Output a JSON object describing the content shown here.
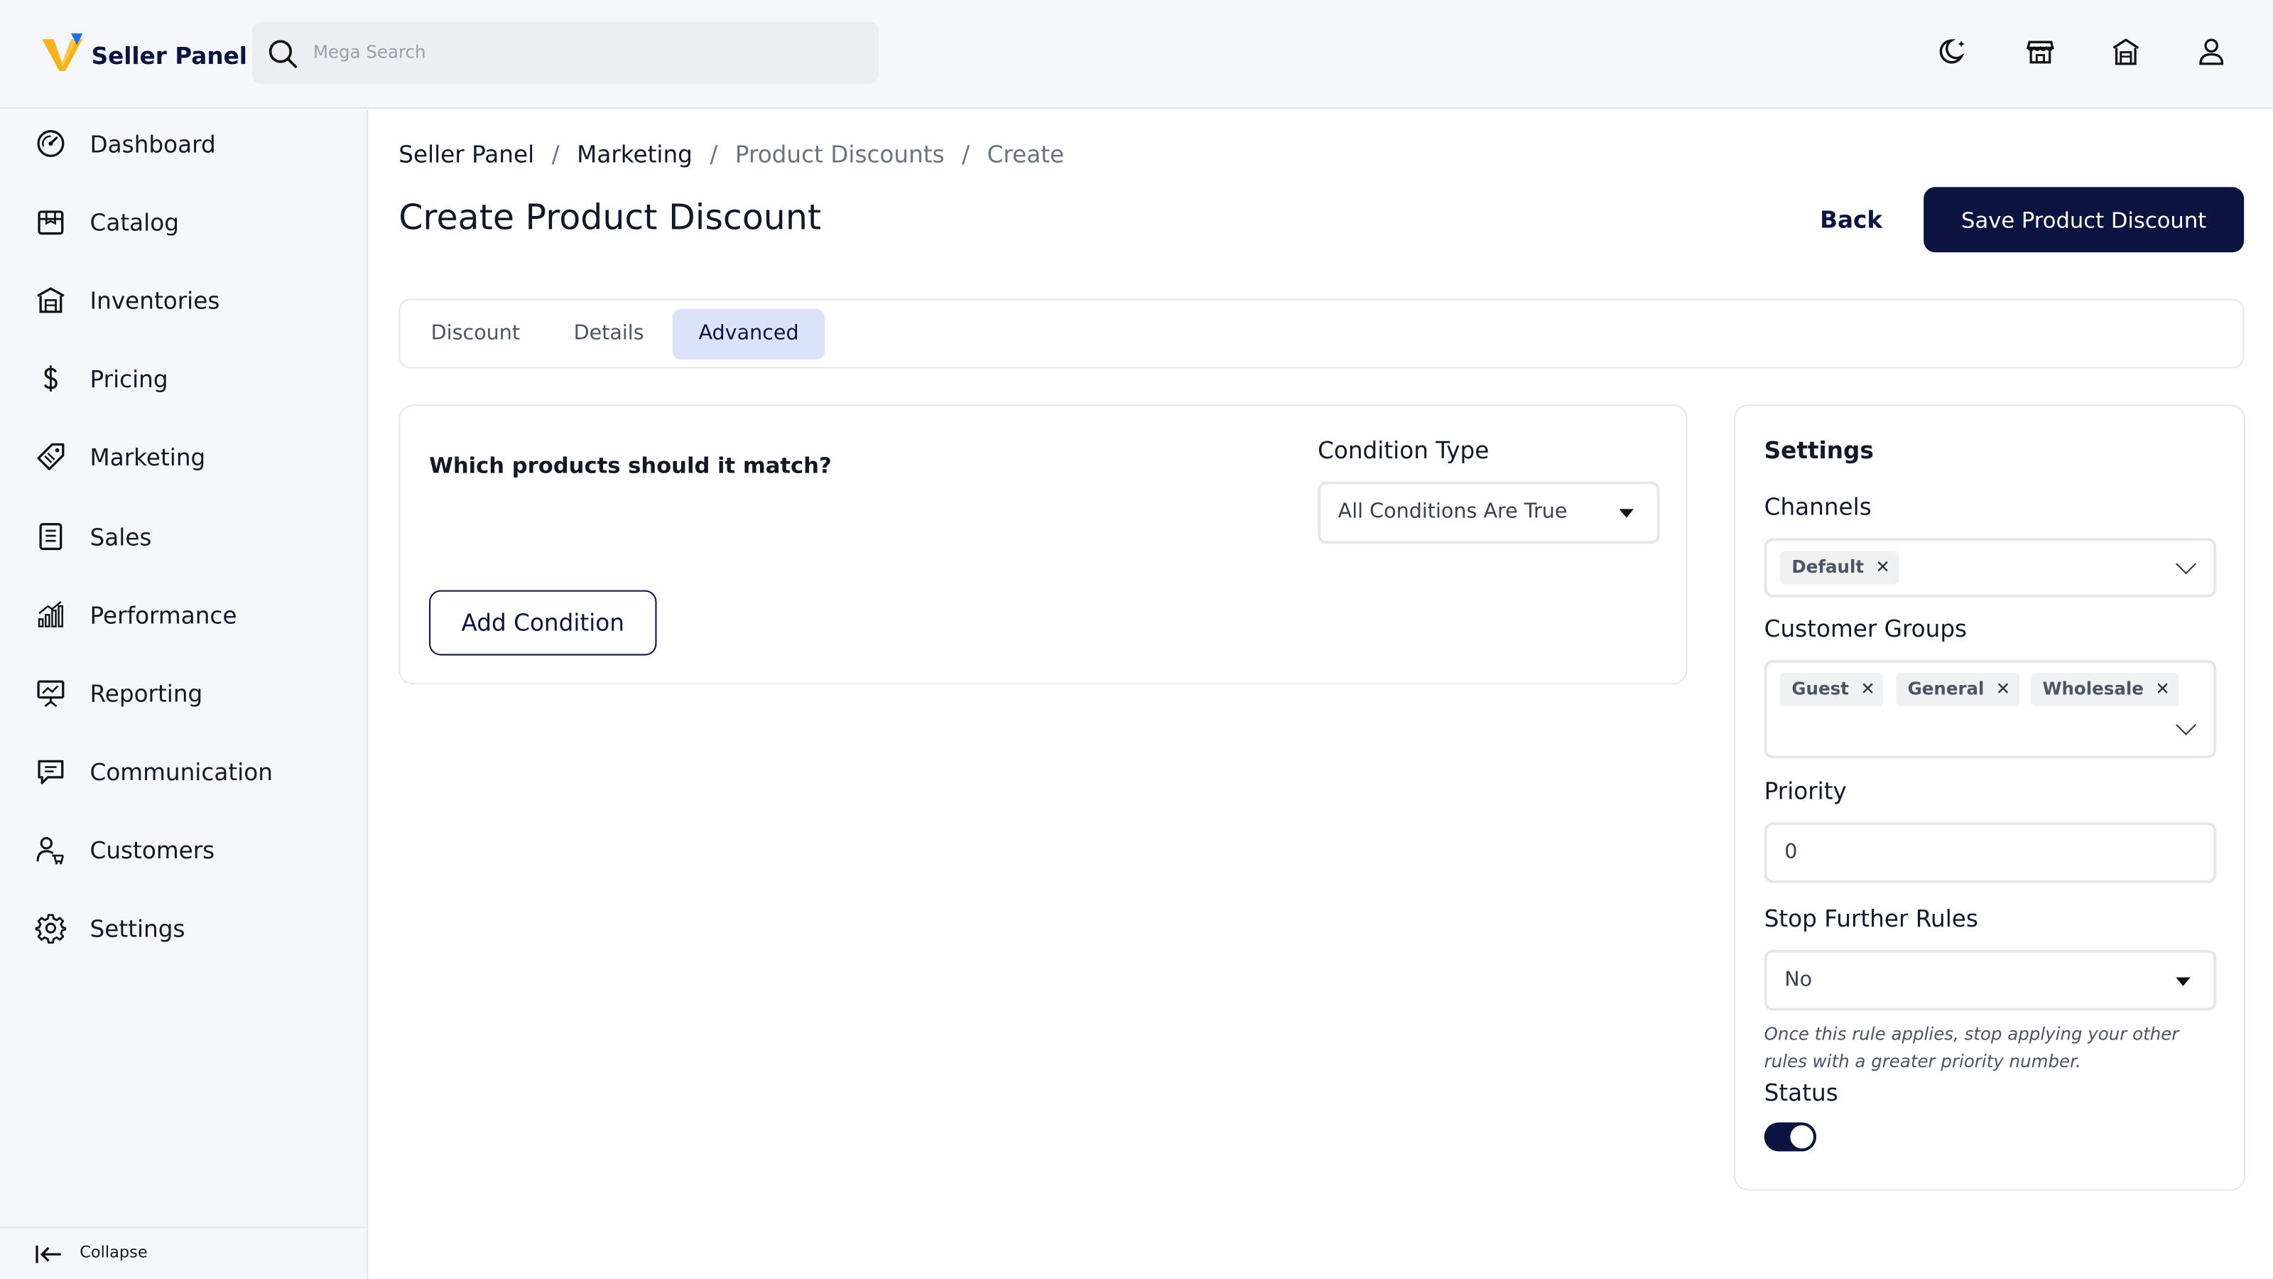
{
  "app": {
    "brand": "Seller Panel"
  },
  "search": {
    "placeholder": "Mega Search",
    "value": ""
  },
  "topbar": {
    "icons": [
      "moon-icon",
      "store-icon",
      "warehouse-icon",
      "user-icon"
    ]
  },
  "sidebar": {
    "items": [
      {
        "label": "Dashboard",
        "icon": "dashboard-icon"
      },
      {
        "label": "Catalog",
        "icon": "catalog-icon"
      },
      {
        "label": "Inventories",
        "icon": "inventories-icon"
      },
      {
        "label": "Pricing",
        "icon": "dollar-icon"
      },
      {
        "label": "Marketing",
        "icon": "tag-icon"
      },
      {
        "label": "Sales",
        "icon": "receipt-icon"
      },
      {
        "label": "Performance",
        "icon": "bar-chart-icon"
      },
      {
        "label": "Reporting",
        "icon": "presentation-icon"
      },
      {
        "label": "Communication",
        "icon": "chat-icon"
      },
      {
        "label": "Customers",
        "icon": "customers-icon"
      },
      {
        "label": "Settings",
        "icon": "gear-icon"
      }
    ],
    "collapse_label": "Collapse"
  },
  "breadcrumb": [
    "Seller Panel",
    "Marketing",
    "Product Discounts",
    "Create"
  ],
  "page": {
    "title": "Create Product Discount",
    "back_label": "Back",
    "save_label": "Save Product Discount"
  },
  "tabs": [
    {
      "label": "Discount",
      "active": false
    },
    {
      "label": "Details",
      "active": false
    },
    {
      "label": "Advanced",
      "active": true
    }
  ],
  "conditions": {
    "question": "Which products should it match?",
    "condition_type_label": "Condition Type",
    "condition_type_value": "All Conditions Are True",
    "add_label": "Add Condition"
  },
  "settings": {
    "title": "Settings",
    "channels_label": "Channels",
    "channels": [
      "Default"
    ],
    "customer_groups_label": "Customer Groups",
    "customer_groups": [
      "Guest",
      "General",
      "Wholesale"
    ],
    "priority_label": "Priority",
    "priority_value": "0",
    "stop_label": "Stop Further Rules",
    "stop_value": "No",
    "stop_hint": "Once this rule applies, stop applying your other rules with a greater priority number.",
    "status_label": "Status",
    "status_on": true
  },
  "colors": {
    "primary": "#0b1340",
    "accent": "#f7b21a",
    "tab_active_bg": "#dbe3fb"
  }
}
